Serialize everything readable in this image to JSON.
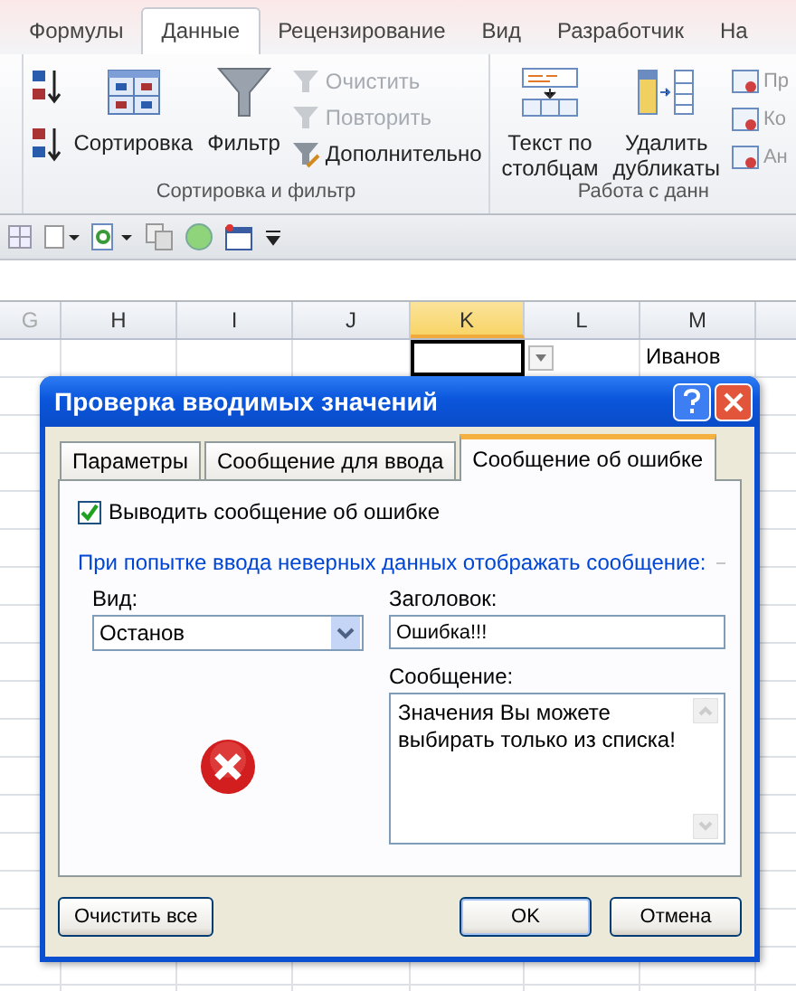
{
  "ribbon_tabs": [
    {
      "label": "Формулы",
      "selected": false
    },
    {
      "label": "Данные",
      "selected": true
    },
    {
      "label": "Рецензирование",
      "selected": false
    },
    {
      "label": "Вид",
      "selected": false
    },
    {
      "label": "Разработчик",
      "selected": false
    },
    {
      "label": "На",
      "selected": false
    }
  ],
  "sort_group": {
    "title": "Сортировка и фильтр",
    "sort_button": "Сортировка",
    "filter_button": "Фильтр",
    "commands": [
      {
        "label": "Очистить",
        "disabled": true
      },
      {
        "label": "Повторить",
        "disabled": true
      },
      {
        "label": "Дополнительно",
        "disabled": false
      }
    ]
  },
  "data_group": {
    "title": "Работа с данн",
    "buttons": [
      {
        "lines": [
          "Текст по",
          "столбцам"
        ]
      },
      {
        "lines": [
          "Удалить",
          "дубликаты"
        ]
      }
    ],
    "small_items": [
      "Пр",
      "Ко",
      "Ан"
    ]
  },
  "columns": [
    {
      "label": "G",
      "selected": false
    },
    {
      "label": "H",
      "selected": false
    },
    {
      "label": "I",
      "selected": false
    },
    {
      "label": "J",
      "selected": false
    },
    {
      "label": "K",
      "selected": true
    },
    {
      "label": "L",
      "selected": false
    },
    {
      "label": "M",
      "selected": false,
      "value": "Иванов"
    }
  ],
  "dialog": {
    "title": "Проверка вводимых значений",
    "tabs": [
      {
        "label": "Параметры",
        "selected": false
      },
      {
        "label": "Сообщение для ввода",
        "selected": false
      },
      {
        "label": "Сообщение об ошибке",
        "selected": true
      }
    ],
    "show_error": {
      "label": "Выводить сообщение об ошибке",
      "checked": true
    },
    "section_label": "При попытке ввода неверных данных отображать сообщение:",
    "style_label": "Вид:",
    "style_value": "Останов",
    "title_label": "Заголовок:",
    "title_value": "Ошибка!!!",
    "message_label": "Сообщение:",
    "message_value": "Значения Вы можете выбирать только из списка!",
    "clear_button": "Очистить все",
    "ok_button": "OK",
    "cancel_button": "Отмена"
  }
}
